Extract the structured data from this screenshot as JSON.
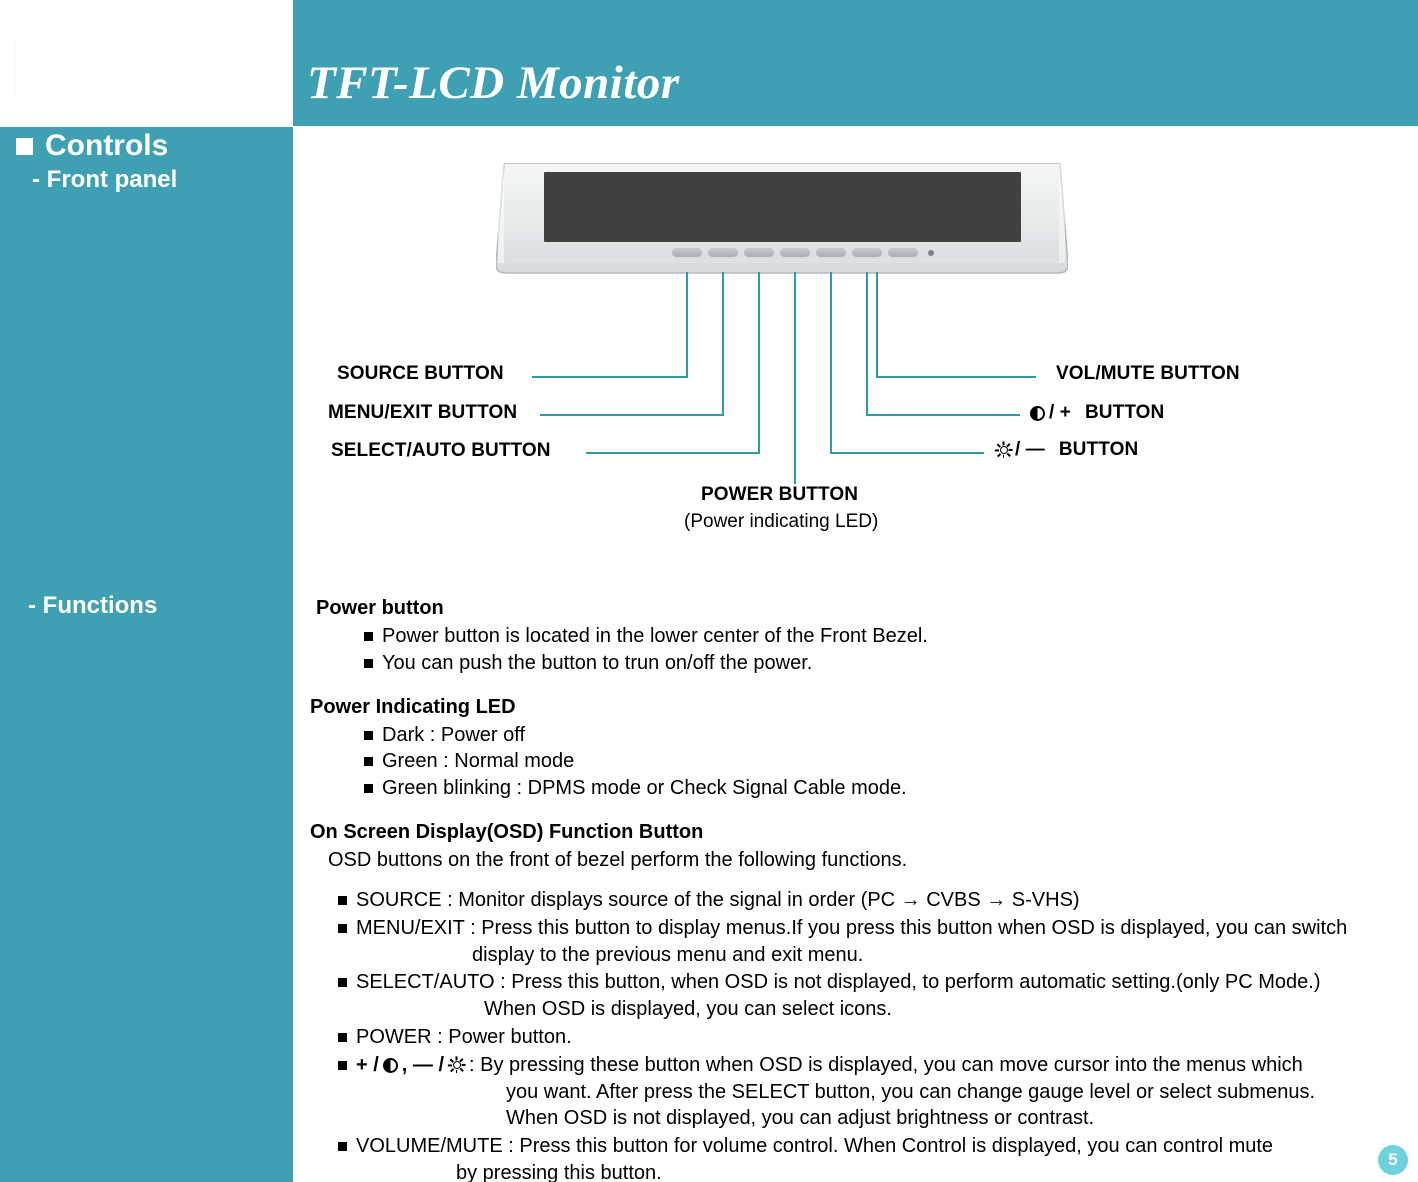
{
  "header": {
    "title": "TFT-LCD Monitor",
    "band_color": "#3fa0b4"
  },
  "sidebar": {
    "background_color": "#3fa0b4",
    "section_title": "Controls",
    "items": [
      {
        "label": "- Front panel"
      },
      {
        "label": "- Functions"
      }
    ]
  },
  "diagram": {
    "line_color": "#2f9aa8",
    "bezel_button_count": 7,
    "callouts_left": [
      {
        "label": "SOURCE BUTTON"
      },
      {
        "label": "MENU/EXIT BUTTON"
      },
      {
        "label": "SELECT/AUTO BUTTON"
      }
    ],
    "callouts_right": [
      {
        "label": "VOL/MUTE BUTTON",
        "icon": ""
      },
      {
        "label": "BUTTON",
        "icon": "contrast-icon",
        "prefix": "/ +"
      },
      {
        "label": "BUTTON",
        "icon": "brightness-icon",
        "prefix": "/ —"
      }
    ],
    "callout_bottom": {
      "label": "POWER BUTTON",
      "sub": "(Power indicating LED)"
    }
  },
  "functions": {
    "power_button": {
      "heading": "Power button",
      "bullets": [
        "Power button is located in the lower center of the Front Bezel.",
        "You can push the button to trun on/off the power."
      ]
    },
    "power_led": {
      "heading": "Power Indicating LED",
      "bullets": [
        "Dark : Power off",
        "Green : Normal mode",
        "Green blinking : DPMS mode or Check Signal Cable mode."
      ]
    },
    "osd": {
      "heading": "On Screen Display(OSD) Function Button",
      "note": "OSD buttons on the front of bezel perform the following functions.",
      "items": {
        "source": "SOURCE : Monitor displays source of the signal in order (PC → CVBS → S-VHS)",
        "menu_exit_l1": "MENU/EXIT : Press this button to display menus.If you press this button when OSD is displayed, you can switch",
        "menu_exit_l2": "display to the previous menu and exit menu.",
        "select_auto_l1": "SELECT/AUTO : Press this button, when OSD is not displayed, to perform automatic setting.(only PC Mode.)",
        "select_auto_l2": "When OSD is displayed, you can select icons.",
        "power": "POWER : Power button.",
        "plusminus_pre": "+ /",
        "plusminus_mid": ", — /",
        "plusminus_l1": ": By pressing these button when OSD is displayed, you can move cursor into the menus which",
        "plusminus_l2": "you want. After press the SELECT button, you can change gauge level or select submenus.",
        "plusminus_l3": "When OSD is not displayed, you can adjust brightness or contrast.",
        "volume_l1": "VOLUME/MUTE : Press this button for volume control. When Control is displayed, you can control mute",
        "volume_l2": "by pressing this button."
      }
    }
  },
  "page": {
    "number": "5",
    "badge_color": "#6ed2de"
  }
}
